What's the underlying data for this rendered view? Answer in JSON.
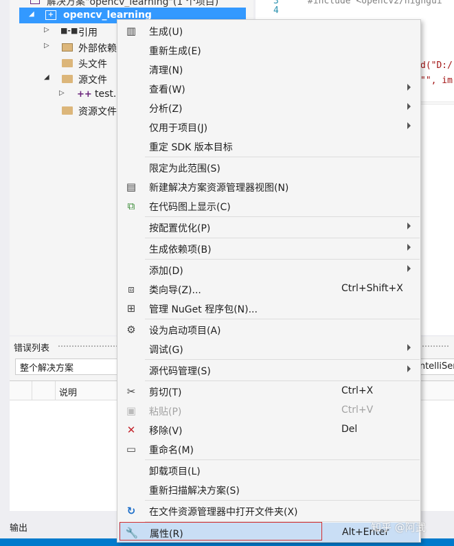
{
  "solution_explorer": {
    "solution_label": "解决方案\"opencv_learning\"(1 个项目)",
    "project": "opencv_learning",
    "items": [
      {
        "label": "引用"
      },
      {
        "label": "外部依赖项"
      },
      {
        "label": "头文件"
      },
      {
        "label": "源文件"
      },
      {
        "label": "test.cpp"
      },
      {
        "label": "资源文件"
      }
    ]
  },
  "editor": {
    "line3": "3",
    "line4": "4",
    "code_line1": "#include <opencv2/highgui",
    "code_line2": "d(\"D:/",
    "code_line3": "\"\", im"
  },
  "context_menu": {
    "items": [
      {
        "label": "生成(U)",
        "icon": "build-icon"
      },
      {
        "label": "重新生成(E)"
      },
      {
        "label": "清理(N)"
      },
      {
        "label": "查看(W)",
        "submenu": true
      },
      {
        "label": "分析(Z)",
        "submenu": true
      },
      {
        "label": "仅用于项目(J)",
        "submenu": true
      },
      {
        "label": "重定 SDK 版本目标"
      },
      {
        "label": "限定为此范围(S)"
      },
      {
        "label": "新建解决方案资源管理器视图(N)",
        "icon": "new-view-icon"
      },
      {
        "label": "在代码图上显示(C)",
        "icon": "code-map-icon"
      },
      {
        "label": "按配置优化(P)",
        "submenu": true
      },
      {
        "label": "生成依赖项(B)",
        "submenu": true
      },
      {
        "label": "添加(D)",
        "submenu": true
      },
      {
        "label": "类向导(Z)...",
        "shortcut": "Ctrl+Shift+X",
        "icon": "class-wizard-icon"
      },
      {
        "label": "管理 NuGet 程序包(N)...",
        "icon": "nuget-icon"
      },
      {
        "label": "设为启动项目(A)",
        "icon": "gear-icon"
      },
      {
        "label": "调试(G)",
        "submenu": true
      },
      {
        "label": "源代码管理(S)",
        "submenu": true
      },
      {
        "label": "剪切(T)",
        "shortcut": "Ctrl+X",
        "icon": "scissors-icon"
      },
      {
        "label": "粘贴(P)",
        "shortcut": "Ctrl+V",
        "icon": "paste-icon",
        "disabled": true
      },
      {
        "label": "移除(V)",
        "shortcut": "Del",
        "icon": "remove-icon"
      },
      {
        "label": "重命名(M)",
        "icon": "rename-icon"
      },
      {
        "label": "卸载项目(L)"
      },
      {
        "label": "重新扫描解决方案(S)"
      },
      {
        "label": "在文件资源管理器中打开文件夹(X)",
        "icon": "refresh-arrow-icon"
      },
      {
        "label": "属性(R)",
        "shortcut": "Alt+Enter",
        "icon": "wrench-icon",
        "highlighted": true
      }
    ]
  },
  "error_list": {
    "title": "错误列表",
    "scope": "整个解决方案",
    "intellisense": "IntelliSen",
    "col_description": "说明"
  },
  "output_tab": "输出",
  "watermark": "知乎 @阿武",
  "colors": {
    "accent": "#007acc",
    "selection": "#3399ff",
    "highlight_box": "#d42b2b"
  }
}
